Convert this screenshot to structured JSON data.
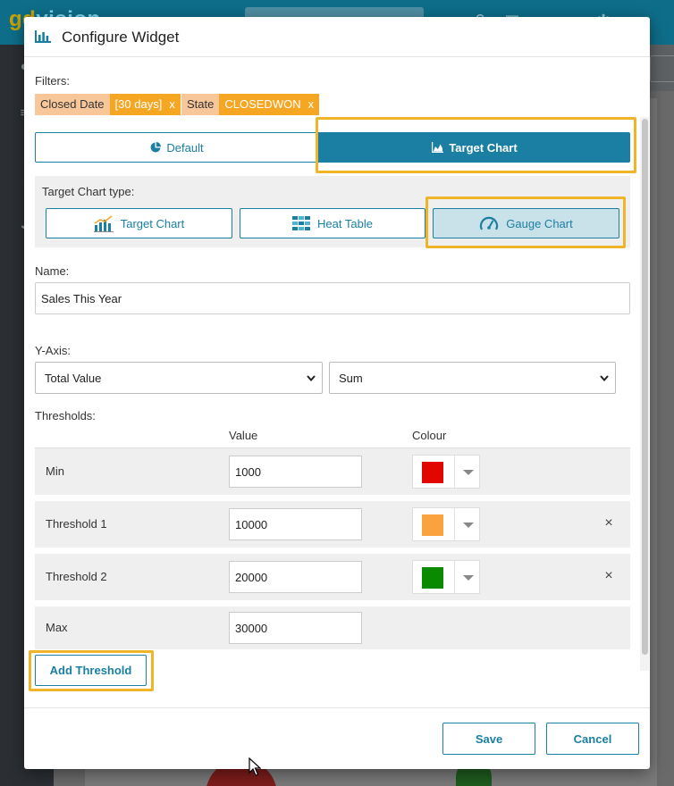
{
  "background": {
    "logo_prefix": "gd",
    "logo_rest": "vision"
  },
  "modal": {
    "title": "Configure Widget",
    "filters_label": "Filters:",
    "filters": [
      {
        "name": "Closed Date",
        "value": "[30 days]",
        "remove": "x"
      },
      {
        "name": "State",
        "value": "CLOSEDWON",
        "remove": "x"
      }
    ],
    "mode_tabs": {
      "default_label": "Default",
      "target_label": "Target Chart",
      "selected": "Target Chart"
    },
    "target_type": {
      "label": "Target Chart type:",
      "options": [
        "Target Chart",
        "Heat Table",
        "Gauge Chart"
      ],
      "selected": "Gauge Chart"
    },
    "name": {
      "label": "Name:",
      "value": "Sales This Year"
    },
    "y_axis": {
      "label": "Y-Axis:",
      "field": "Total Value",
      "aggregate": "Sum"
    },
    "thresholds": {
      "label": "Thresholds:",
      "col_value": "Value",
      "col_colour": "Colour",
      "remove_symbol": "×",
      "rows": [
        {
          "name": "Min",
          "value": "1000",
          "colour": "#e10600"
        },
        {
          "name": "Threshold 1",
          "value": "10000",
          "colour": "#f9a23e"
        },
        {
          "name": "Threshold 2",
          "value": "20000",
          "colour": "#0a8a00"
        },
        {
          "name": "Max",
          "value": "30000"
        }
      ]
    },
    "add_threshold_label": "Add Threshold",
    "save_label": "Save",
    "cancel_label": "Cancel"
  },
  "colors": {
    "accent": "#1a7fa3",
    "highlight": "#f0b429",
    "chip_name": "#f7c79a",
    "chip_value": "#f5a623"
  }
}
